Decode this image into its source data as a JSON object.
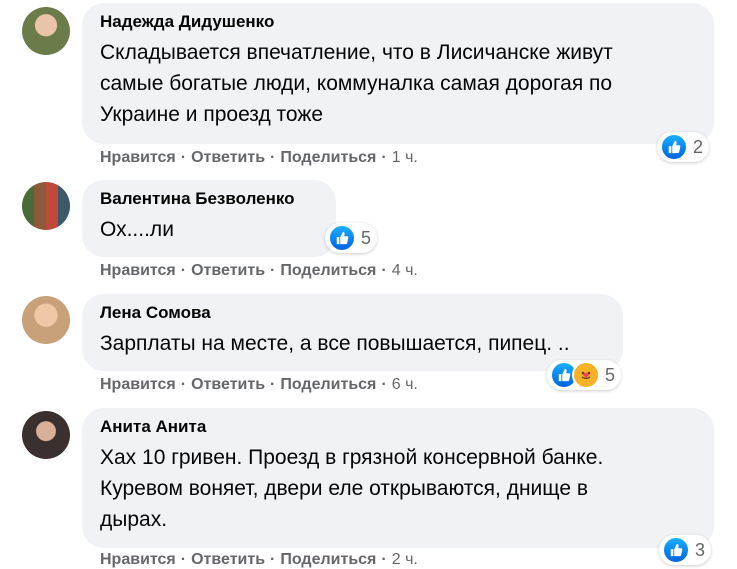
{
  "comments": [
    {
      "author": "Надежда Дидушенко",
      "text_lines": [
        "Складывается впечатление, что в Лисичанске живут",
        "самые богатые люди, коммуналка самая дорогая по",
        "Украине и проезд тоже"
      ],
      "actions": [
        "Нравится",
        "Ответить",
        "Поделиться"
      ],
      "time": "1 ч.",
      "reaction_count": "2",
      "reactions": [
        "like-icon"
      ],
      "avatar_color": "#6b7c4a"
    },
    {
      "author": "Валентина Безволенко",
      "text_lines": [
        "Ох....ли"
      ],
      "actions": [
        "Нравится",
        "Ответить",
        "Поделиться"
      ],
      "time": "4 ч.",
      "reaction_count": "5",
      "reactions": [
        "like-icon"
      ],
      "avatar_color": "#8a5a3a"
    },
    {
      "author": "Лена Сомова",
      "text_lines": [
        "Зарплаты на месте, а все повышается, пипец. .."
      ],
      "actions": [
        "Нравится",
        "Ответить",
        "Поделиться"
      ],
      "time": "6 ч.",
      "reaction_count": "5",
      "reactions": [
        "like-icon",
        "care-icon"
      ],
      "avatar_color": "#c8a07a"
    },
    {
      "author": "Анита Анита",
      "text_lines": [
        "Хах 10 гривен. Проезд в грязной консервной банке.",
        "Куревом воняет, двери еле открываются, днище в",
        "дырах."
      ],
      "actions": [
        "Нравится",
        "Ответить",
        "Поделиться"
      ],
      "time": "2 ч.",
      "reaction_count": "3",
      "reactions": [
        "like-icon"
      ],
      "avatar_color": "#3a3030"
    }
  ],
  "colors": {
    "bubble": "#f0f2f5",
    "meta": "#65676b",
    "like": "#1877f2",
    "care": "#f7b125"
  }
}
